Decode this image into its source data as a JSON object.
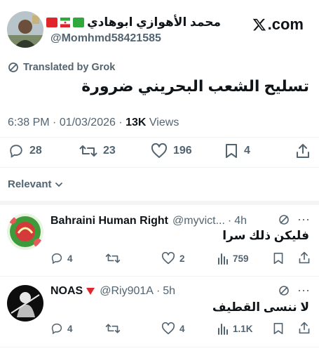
{
  "brand": {
    "label": ".com"
  },
  "author": {
    "name": "محمد الأهوازي ابوهادي",
    "handle": "@Momhmd58421585"
  },
  "translation_label": "Translated by Grok",
  "tweet": {
    "text": "تسليح الشعب البحريني ضرورة",
    "time": "6:38 PM",
    "date": "01/03/2026",
    "views_count": "13K",
    "views_label": "Views"
  },
  "actions": {
    "replies": "28",
    "reposts": "23",
    "likes": "196",
    "bookmarks": "4"
  },
  "sort": {
    "label": "Relevant"
  },
  "replies": [
    {
      "name": "Bahraini Human Right",
      "handle": "@myvict...",
      "time": "4h",
      "text": "فليكن ذلك سرا",
      "replies": "4",
      "reposts": "",
      "likes": "2",
      "views": "759"
    },
    {
      "name": "NOAS",
      "handle": "@Riy901A",
      "time": "5h",
      "text": "لا ننسى القطيف",
      "replies": "4",
      "reposts": "",
      "likes": "4",
      "views": "1.1K"
    }
  ],
  "colors": {
    "text": "#0f1419",
    "muted": "#536471",
    "divider": "#eff3f4",
    "flag_red": "#e0262b",
    "flag_green": "#2fa83c"
  }
}
